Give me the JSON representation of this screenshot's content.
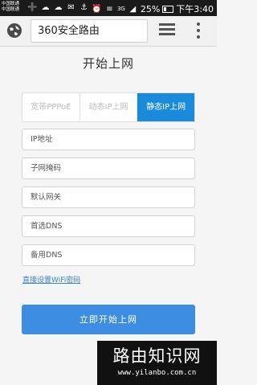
{
  "status_bar": {
    "carrier1": "中国联通",
    "carrier2": "中国联通",
    "network": "3G",
    "battery": "25%",
    "time": "下午3:40"
  },
  "browser": {
    "url": "360安全路由"
  },
  "page": {
    "title": "开始上网",
    "tabs": [
      {
        "label": "宽带PPPoE",
        "active": false
      },
      {
        "label": "动态IP上网",
        "active": false
      },
      {
        "label": "静态IP上网",
        "active": true
      }
    ],
    "fields": {
      "ip": "IP地址",
      "subnet": "子网掩码",
      "gateway": "默认网关",
      "dns1": "首选DNS",
      "dns2": "备用DNS"
    },
    "wifi_link": "直接设置WiFi密码",
    "submit": "立即开始上网"
  },
  "watermark": {
    "title": "路由知识网",
    "url": "www.yilanbo.com.cn"
  },
  "colors": {
    "active_tab": "#1a8bda",
    "primary_button": "#3d8de3",
    "link": "#3b82c4"
  }
}
